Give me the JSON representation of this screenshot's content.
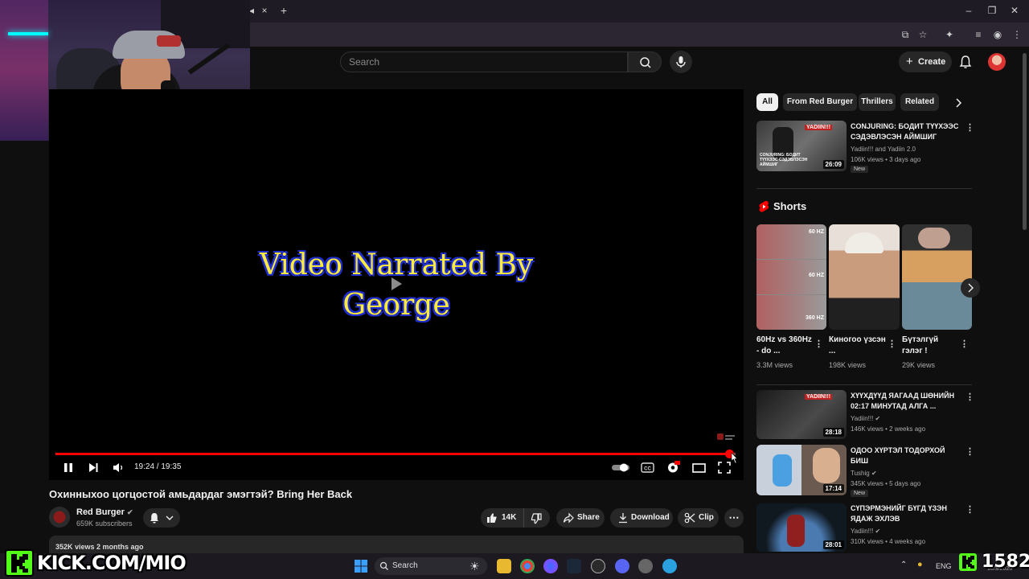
{
  "browser": {
    "close_tab_symbol": "×",
    "new_tab_symbol": "+"
  },
  "header": {
    "search_placeholder": "Search",
    "create_label": "Create"
  },
  "overlay": {
    "kick_text": "KICK.COM/MIO",
    "viewer_count": "1582"
  },
  "player": {
    "narration_line1": "Video Narrated By",
    "narration_line2": "George",
    "current_time": "19:24",
    "duration": "19:35",
    "timecode": "19:24 / 19:35",
    "progress": 0.991
  },
  "video": {
    "title": "Охинныхоо цогцостой амьдардаг эмэгтэй? Bring Her Back",
    "channel_name": "Red Burger",
    "subscribers": "659K subscribers",
    "likes": "14K",
    "share_label": "Share",
    "download_label": "Download",
    "clip_label": "Clip",
    "meta": "352K views  2 months ago"
  },
  "sidebar": {
    "chips": [
      "All",
      "From Red Burger",
      "Thrillers",
      "Related"
    ],
    "top_video": {
      "title": "CONJURING: БОДИТ ТҮҮХЭЭС СЭДЭВЛЭСЭН АЙМШИГ",
      "channel": "Yadiin!!! and Yadiin 2.0",
      "meta": "106K views • 3 days ago",
      "badge": "New",
      "duration": "26:09",
      "thumb_text": "CONJURING: БОДИТ ТҮҮХЭЭС СЭДЭВЛЭСЭН АЙМШИГ"
    },
    "shorts_heading": "Shorts",
    "shorts": [
      {
        "title": "60Hz vs 360Hz - do ...",
        "views": "3.3M views",
        "labels": [
          "60 HZ",
          "60 HZ",
          "360 HZ"
        ]
      },
      {
        "title": "Киногоо үзсэн ...",
        "views": "198K views"
      },
      {
        "title": "Бүтэлгүй гэлэг !",
        "views": "29K views"
      }
    ],
    "videos": [
      {
        "title": "ХҮҮХДҮҮД ЯАГААД ШӨНИЙН 02:17 МИНУТАД АЛГА ...",
        "channel": "Yadiin!!!",
        "meta": "146K views • 2 weeks ago",
        "duration": "28:18"
      },
      {
        "title": "ОДОО ХҮРТЭЛ ТОДОРХОЙ БИШ",
        "channel": "Tushig",
        "meta": "345K views • 5 days ago",
        "badge": "New",
        "duration": "17:14"
      },
      {
        "title": "СҮПЭРМЭНИЙГ БҮГД ҮЗЭН ЯДАЖ ЭХЛЭВ",
        "channel": "Yadiin!!!",
        "meta": "310K views • 4 weeks ago",
        "duration": "28:01"
      }
    ]
  },
  "taskbar": {
    "search_label": "Search",
    "lang": "ENG",
    "date": "10/3/2025"
  },
  "colors": {
    "accent": "#ff0000",
    "kick_green": "#53fc18",
    "narration_yellow": "#ffeb3b"
  }
}
